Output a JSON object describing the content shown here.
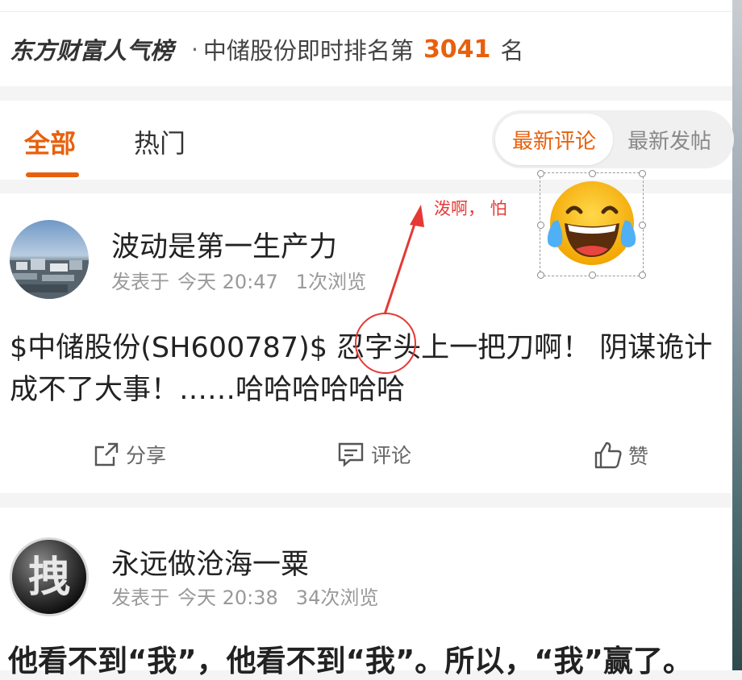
{
  "ranking": {
    "brand": "东方财富人气榜",
    "separator": "·",
    "prefix": "中储股份即时排名第",
    "rank": "3041",
    "suffix": "名"
  },
  "tabs": {
    "all": "全部",
    "hot": "热门"
  },
  "sort": {
    "latest_comment": "最新评论",
    "latest_post": "最新发帖"
  },
  "posts": [
    {
      "author": "波动是第一生产力",
      "posted_prefix": "发表于",
      "time": "今天 20:47",
      "views": "1次浏览",
      "content": "$中储股份(SH600787)$ 忍字头上一把刀啊！ 阴谋诡计成不了大事！……哈哈哈哈哈哈",
      "share_label": "分享",
      "comment_label": "评论",
      "like_label": "赞"
    },
    {
      "author": "永远做沧海一粟",
      "posted_prefix": "发表于",
      "time": "今天 20:38",
      "views": "34次浏览",
      "content": "他看不到“我”，他看不到“我”。所以，“我”赢了。",
      "avatar_char": "拽"
    }
  ],
  "annotation": {
    "note": "泼啊， 怕",
    "emoji": "tears-of-joy-emoji",
    "color": "#e53935"
  },
  "colors": {
    "accent": "#e8600c",
    "muted": "#999999"
  }
}
